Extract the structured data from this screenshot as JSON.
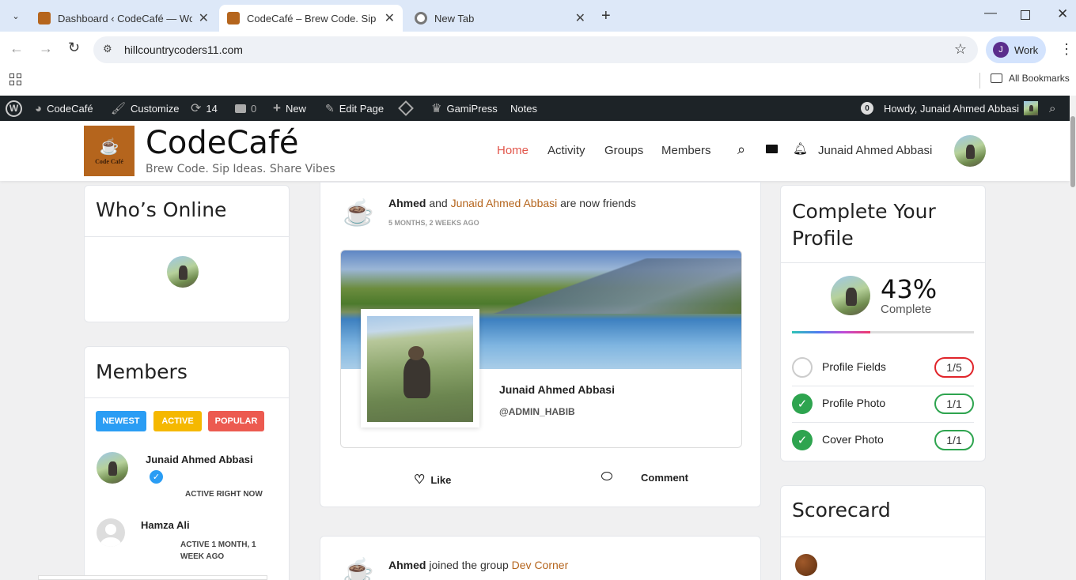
{
  "browser": {
    "tabs": [
      {
        "title": "Dashboard ‹ CodeCafé — WordPress",
        "active": false
      },
      {
        "title": "CodeCafé – Brew Code. Sip Ideas",
        "active": true
      },
      {
        "title": "New Tab",
        "active": false
      }
    ],
    "url": "hillcountrycoders11.com",
    "profile_label": "Work",
    "profile_initial": "J",
    "bookmarks_label": "All Bookmarks"
  },
  "admin_bar": {
    "site": "CodeCafé",
    "customize": "Customize",
    "updates": "14",
    "comments": "0",
    "new": "New",
    "edit_page": "Edit Page",
    "gamipress": "GamiPress",
    "notes": "Notes",
    "notif_count": "0",
    "howdy": "Howdy, Junaid Ahmed Abbasi"
  },
  "site": {
    "logo_text": "Code Café",
    "title": "CodeCafé",
    "tagline": "Brew Code. Sip Ideas. Share Vibes",
    "nav": [
      "Home",
      "Activity",
      "Groups",
      "Members"
    ],
    "user_name": "Junaid Ahmed Abbasi"
  },
  "whos_online": {
    "title": "Who’s Online"
  },
  "members": {
    "title": "Members",
    "filters": [
      "NEWEST",
      "ACTIVE",
      "POPULAR"
    ],
    "list": [
      {
        "name": "Junaid Ahmed Abbasi",
        "status": "ACTIVE RIGHT NOW"
      },
      {
        "name": "Hamza Ali",
        "status": "ACTIVE 1 MONTH, 1 WEEK AGO"
      }
    ]
  },
  "activity": [
    {
      "actor": "Ahmed",
      "connector": "and",
      "target": "Junaid Ahmed Abbasi",
      "action": "are now friends",
      "time": "5 MONTHS, 2 WEEKS AGO",
      "card_name": "Junaid Ahmed Abbasi",
      "card_handle": "@ADMIN_HABIB",
      "like": "Like",
      "comment": "Comment"
    },
    {
      "actor": "Ahmed",
      "action": "joined the group",
      "target": "Dev Corner"
    }
  ],
  "profile_completion": {
    "title": "Complete Your Profile",
    "percent": "43%",
    "percent_value": 43,
    "sub": "Complete",
    "items": [
      {
        "label": "Profile Fields",
        "value": "1/5",
        "done": false
      },
      {
        "label": "Profile Photo",
        "value": "1/1",
        "done": true
      },
      {
        "label": "Cover Photo",
        "value": "1/1",
        "done": true
      }
    ]
  },
  "scorecard": {
    "title": "Scorecard"
  },
  "colors": {
    "accent": "#b5651d",
    "nav_active": "#e2574c",
    "newest": "#2a9df4",
    "active": "#f5b800",
    "popular": "#ec5a50",
    "green": "#2ea44f",
    "red": "#e0252b"
  }
}
